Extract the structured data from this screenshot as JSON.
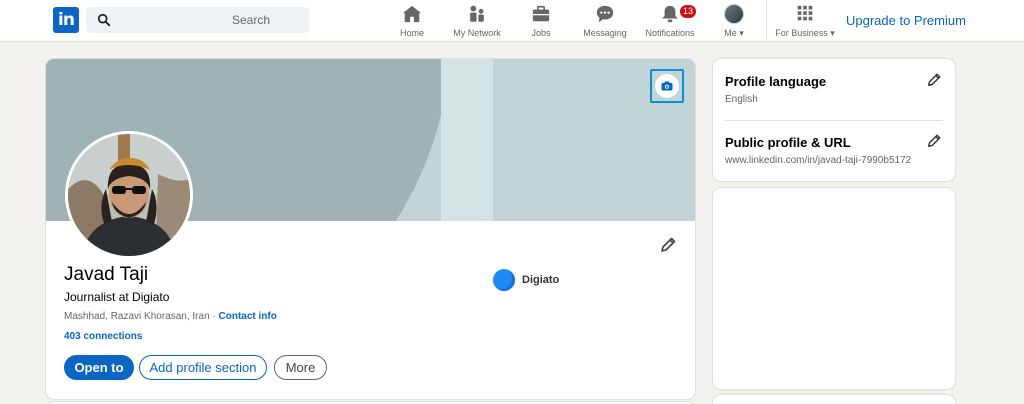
{
  "nav": {
    "logo_text": "in",
    "search_placeholder": "Search",
    "items": [
      {
        "label": "Home",
        "icon": "home-icon"
      },
      {
        "label": "My Network",
        "icon": "network-icon"
      },
      {
        "label": "Jobs",
        "icon": "briefcase-icon"
      },
      {
        "label": "Messaging",
        "icon": "messaging-icon"
      },
      {
        "label": "Notifications",
        "icon": "bell-icon"
      },
      {
        "label": "Me",
        "icon": "avatar"
      }
    ],
    "notifications_count": "13",
    "for_business": "For Business",
    "premium": "Upgrade to Premium"
  },
  "profile": {
    "name": "Javad Taji",
    "headline": "Journalist at Digiato",
    "location": "Mashhad, Razavi Khorasan, Iran",
    "separator": " · ",
    "contact_info": "Contact info",
    "connections": "403 connections",
    "company": "Digiato",
    "buttons": {
      "open_to": "Open to",
      "add_section": "Add profile section",
      "more": "More"
    }
  },
  "sidebar": {
    "language_title": "Profile language",
    "language_value": "English",
    "url_title": "Public profile & URL",
    "url_value": "www.linkedin.com/in/javad-taji-7990b5172"
  },
  "colors": {
    "brand": "#0a66c2",
    "badge": "#cc1016",
    "page_bg": "#f3f2ef"
  }
}
